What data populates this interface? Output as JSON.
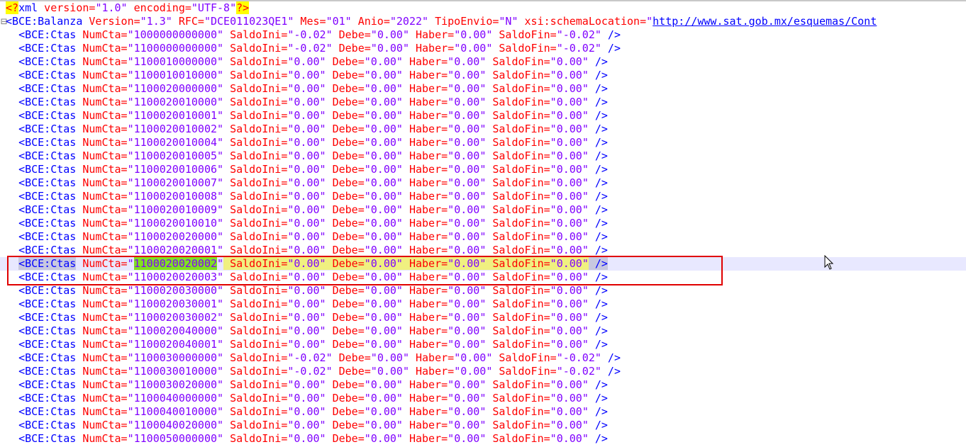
{
  "editor": {
    "xml_decl": {
      "open": "<?",
      "name": "xml",
      "version_attr": " version=",
      "version_val": "\"1.0\"",
      "encoding_attr": " encoding=",
      "encoding_val": "\"UTF-8\"",
      "close": "?>"
    },
    "root": {
      "fold": "⊟",
      "open_tag": "<BCE:Balanza",
      "attrs": [
        {
          "name": " Version=",
          "value": "\"1.3\""
        },
        {
          "name": " RFC=",
          "value": "\"DCE011023QE1\""
        },
        {
          "name": " Mes=",
          "value": "\"01\""
        },
        {
          "name": " Anio=",
          "value": "\"2022\""
        },
        {
          "name": " TipoEnvio=",
          "value": "\"N\""
        }
      ],
      "schema_attr": " xsi:schemaLocation=",
      "schema_quote": "\"",
      "schema_link": "http://www.sat.gob.mx/esquemas/Cont"
    },
    "row_labels": {
      "tag": "<BCE:Ctas",
      "numcta": " NumCta=",
      "saldoini": " SaldoIni=",
      "debe": " Debe=",
      "haber": " Haber=",
      "saldofin": " SaldoFin=",
      "close": " />",
      "indent": "  "
    },
    "rows": [
      {
        "numcta": "1000000000000",
        "saldoini": "-0.02",
        "debe": "0.00",
        "haber": "0.00",
        "saldofin": "-0.02"
      },
      {
        "numcta": "1100000000000",
        "saldoini": "-0.02",
        "debe": "0.00",
        "haber": "0.00",
        "saldofin": "-0.02"
      },
      {
        "numcta": "1100010000000",
        "saldoini": "0.00",
        "debe": "0.00",
        "haber": "0.00",
        "saldofin": "0.00"
      },
      {
        "numcta": "1100010010000",
        "saldoini": "0.00",
        "debe": "0.00",
        "haber": "0.00",
        "saldofin": "0.00"
      },
      {
        "numcta": "1100020000000",
        "saldoini": "0.00",
        "debe": "0.00",
        "haber": "0.00",
        "saldofin": "0.00"
      },
      {
        "numcta": "1100020010000",
        "saldoini": "0.00",
        "debe": "0.00",
        "haber": "0.00",
        "saldofin": "0.00"
      },
      {
        "numcta": "1100020010001",
        "saldoini": "0.00",
        "debe": "0.00",
        "haber": "0.00",
        "saldofin": "0.00"
      },
      {
        "numcta": "1100020010002",
        "saldoini": "0.00",
        "debe": "0.00",
        "haber": "0.00",
        "saldofin": "0.00"
      },
      {
        "numcta": "1100020010004",
        "saldoini": "0.00",
        "debe": "0.00",
        "haber": "0.00",
        "saldofin": "0.00"
      },
      {
        "numcta": "1100020010005",
        "saldoini": "0.00",
        "debe": "0.00",
        "haber": "0.00",
        "saldofin": "0.00"
      },
      {
        "numcta": "1100020010006",
        "saldoini": "0.00",
        "debe": "0.00",
        "haber": "0.00",
        "saldofin": "0.00"
      },
      {
        "numcta": "1100020010007",
        "saldoini": "0.00",
        "debe": "0.00",
        "haber": "0.00",
        "saldofin": "0.00"
      },
      {
        "numcta": "1100020010008",
        "saldoini": "0.00",
        "debe": "0.00",
        "haber": "0.00",
        "saldofin": "0.00"
      },
      {
        "numcta": "1100020010009",
        "saldoini": "0.00",
        "debe": "0.00",
        "haber": "0.00",
        "saldofin": "0.00"
      },
      {
        "numcta": "1100020010010",
        "saldoini": "0.00",
        "debe": "0.00",
        "haber": "0.00",
        "saldofin": "0.00"
      },
      {
        "numcta": "1100020020000",
        "saldoini": "0.00",
        "debe": "0.00",
        "haber": "0.00",
        "saldofin": "0.00"
      },
      {
        "numcta": "1100020020001",
        "saldoini": "0.00",
        "debe": "0.00",
        "haber": "0.00",
        "saldofin": "0.00"
      },
      {
        "numcta": "1100020020002",
        "saldoini": "0.00",
        "debe": "0.00",
        "haber": "0.00",
        "saldofin": "0.00",
        "current": true
      },
      {
        "numcta": "1100020020003",
        "saldoini": "0.00",
        "debe": "0.00",
        "haber": "0.00",
        "saldofin": "0.00"
      },
      {
        "numcta": "1100020030000",
        "saldoini": "0.00",
        "debe": "0.00",
        "haber": "0.00",
        "saldofin": "0.00"
      },
      {
        "numcta": "1100020030001",
        "saldoini": "0.00",
        "debe": "0.00",
        "haber": "0.00",
        "saldofin": "0.00"
      },
      {
        "numcta": "1100020030002",
        "saldoini": "0.00",
        "debe": "0.00",
        "haber": "0.00",
        "saldofin": "0.00"
      },
      {
        "numcta": "1100020040000",
        "saldoini": "0.00",
        "debe": "0.00",
        "haber": "0.00",
        "saldofin": "0.00"
      },
      {
        "numcta": "1100020040001",
        "saldoini": "0.00",
        "debe": "0.00",
        "haber": "0.00",
        "saldofin": "0.00"
      },
      {
        "numcta": "1100030000000",
        "saldoini": "-0.02",
        "debe": "0.00",
        "haber": "0.00",
        "saldofin": "-0.02"
      },
      {
        "numcta": "1100030010000",
        "saldoini": "-0.02",
        "debe": "0.00",
        "haber": "0.00",
        "saldofin": "-0.02"
      },
      {
        "numcta": "1100030020000",
        "saldoini": "0.00",
        "debe": "0.00",
        "haber": "0.00",
        "saldofin": "0.00"
      },
      {
        "numcta": "1100040000000",
        "saldoini": "0.00",
        "debe": "0.00",
        "haber": "0.00",
        "saldofin": "0.00"
      },
      {
        "numcta": "1100040010000",
        "saldoini": "0.00",
        "debe": "0.00",
        "haber": "0.00",
        "saldofin": "0.00"
      },
      {
        "numcta": "1100040020000",
        "saldoini": "0.00",
        "debe": "0.00",
        "haber": "0.00",
        "saldofin": "0.00"
      },
      {
        "numcta": "1100050000000",
        "saldoini": "0.00",
        "debe": "0.00",
        "haber": "0.00",
        "saldofin": "0.00"
      }
    ]
  },
  "colors": {
    "tag": "#0000ff",
    "attribute": "#ff0000",
    "value": "#8000ff",
    "current_line": "#e8e8ff",
    "annotation_box": "#e00000",
    "selection": "#80e020"
  }
}
